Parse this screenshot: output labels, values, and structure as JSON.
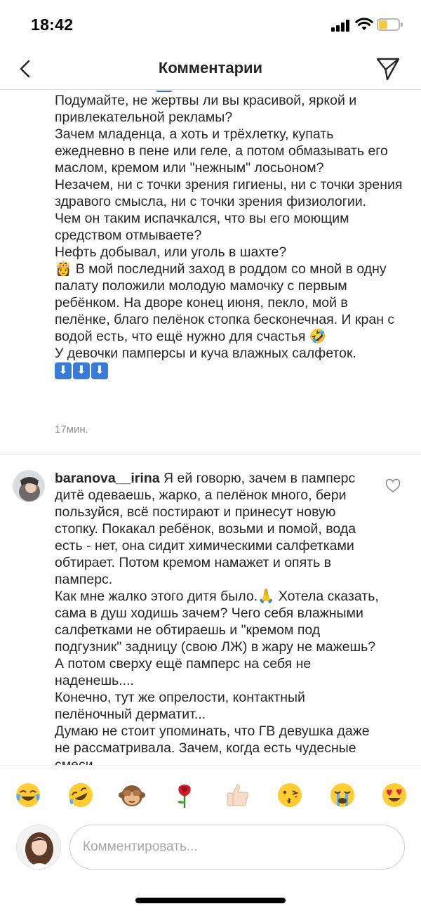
{
  "status_bar": {
    "time": "18:42"
  },
  "nav": {
    "title": "Комментарии",
    "back_icon": "chevron-left-icon",
    "send_icon": "paper-plane-icon"
  },
  "comments": [
    {
      "paragraphs": [
        "Подумайте, не жертвы ли вы красивой, яркой и привлекательной рекламы?",
        "Зачем младенца, а хоть и трёхлетку, купать ежедневно в пене или геле, а потом обмазывать его маслом, кремом или \"нежным\" лосьоном?",
        "Незачем, ни с точки зрения гигиены, ни с точки зрения здравого смысла, ни с точки зрения физиологии.",
        "Чем он таким испачкался, что вы его моющим средством отмываете?",
        "Нефть добывал, или уголь в шахте?",
        "В мой последний заход в роддом со мной в одну палату положили молодую мамочку с первым ребёнком. На дворе конец июня, пекло, мой в пелёнке, благо пелёнок стопка бесконечная. И кран с водой есть, что ещё нужно для счастья",
        "У девочки памперсы и куча влажных салфеток."
      ],
      "emoji_lead": "👸",
      "emoji_laugh": "🤣",
      "arrow_glyph": "⬇",
      "time": "17мин."
    },
    {
      "username": "baranova__irina",
      "paragraphs": [
        "Я ей говорю, зачем в памперс дитё одеваешь, жарко, а пелёнок много, бери пользуйся, всё постирают и принесут новую стопку. Покакал ребёнок, возьми и помой, вода есть - нет, она сидит химическими салфетками обтирает. Потом кремом намажет и опять в памперс.",
        "Как мне жалко этого дитя было.",
        "Хотела сказать, сама в душ ходишь зачем? Чего себя влажными салфетками не обтираешь и \"кремом под подгузник\" задницу (свою ЛЖ) в жару не мажешь? А потом сверху ещё памперс на себя не наденешь....",
        "Конечно, тут же опрелости, контактный пелёночный дерматит...",
        "Думаю не стоит упоминать, что ГВ девушка даже не рассматривала. Зачем, когда есть чудесные смеси."
      ],
      "emoji_pray": "🙏",
      "like_icon": "heart-outline-icon"
    }
  ],
  "reactions": [
    {
      "name": "tears-of-joy-emoji",
      "glyph": "😂"
    },
    {
      "name": "rolling-laughing-emoji",
      "glyph": "🤣"
    },
    {
      "name": "see-no-evil-monkey-emoji",
      "glyph": "🙈"
    },
    {
      "name": "rose-emoji",
      "glyph": "🌹"
    },
    {
      "name": "thumbs-up-emoji",
      "glyph": "👍🏻"
    },
    {
      "name": "kissing-face-emoji",
      "glyph": "😘"
    },
    {
      "name": "crying-face-emoji",
      "glyph": "😭"
    },
    {
      "name": "heart-eyes-emoji",
      "glyph": "😍"
    }
  ],
  "composer": {
    "placeholder": "Комментировать..."
  },
  "colors": {
    "text": "#262626",
    "secondary": "#8e8e8e",
    "divider": "#dbdbdb",
    "battery": "#f5c842",
    "arrow_blue": "#3a7bd5"
  }
}
